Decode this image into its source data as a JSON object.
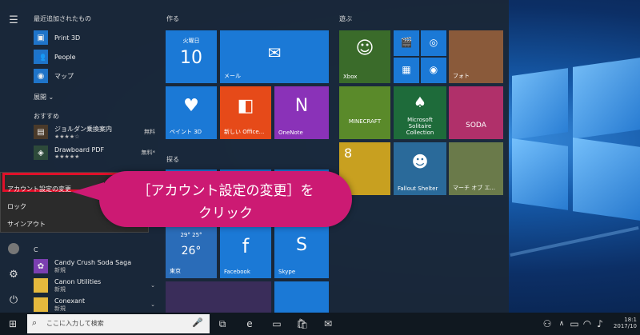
{
  "start": {
    "recent_header": "最近追加されたもの",
    "recent_apps": [
      {
        "label": "Print 3D"
      },
      {
        "label": "People"
      },
      {
        "label": "マップ"
      }
    ],
    "expand_label": "展開",
    "recommended_header": "おすすめ",
    "recommended_apps": [
      {
        "label": "ジョルダン乗換案内",
        "badge": "無料",
        "rating": "★★★★☆"
      },
      {
        "label": "Drawboard PDF",
        "badge": "無料*",
        "rating": "★★★★★"
      }
    ],
    "letter_c": "C",
    "c_apps": [
      {
        "label": "Candy Crush Soda Saga",
        "sub": "新規"
      },
      {
        "label": "Canon Utilities",
        "sub": "新規"
      },
      {
        "label": "Conexant",
        "sub": "新規"
      }
    ]
  },
  "account_menu": {
    "items": [
      "アカウント設定の変更",
      "ロック",
      "サインアウト"
    ]
  },
  "callout": {
    "line1": "［アカウント設定の変更］を",
    "line2": "クリック"
  },
  "groups": {
    "create": "作る",
    "play": "遊ぶ",
    "explore": "探る"
  },
  "tiles": {
    "calendar_day": "火曜日",
    "calendar_date": "10",
    "mail": "メール",
    "paint3d": "ペイント 3D",
    "office": "新しい Office...",
    "onenote": "OneNote",
    "xbox": "Xbox",
    "photos": "フォト",
    "solitaire": "Microsoft Solitaire Collection",
    "weather_temp1": "26°",
    "weather_temp2": "29°",
    "weather_temp3": "25°",
    "weather_city": "東京",
    "facebook": "Facebook",
    "skype": "Skype",
    "soda": "SODA",
    "fallout": "Fallout Shelter",
    "march": "マーチ オブ エ..."
  },
  "taskbar": {
    "search_placeholder": "ここに入力して検索",
    "time": "18:1",
    "date": "2017/10"
  }
}
